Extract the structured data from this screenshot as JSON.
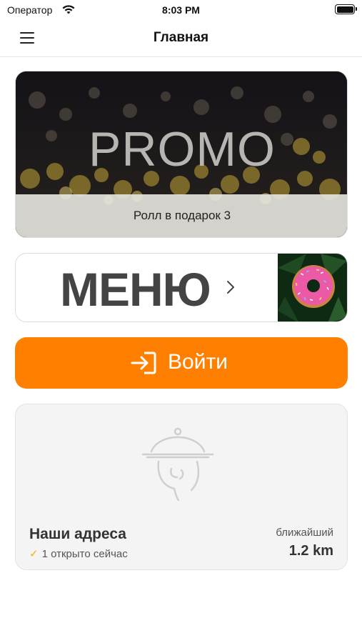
{
  "status_bar": {
    "carrier": "Оператор",
    "time": "8:03 PM"
  },
  "nav": {
    "title": "Главная"
  },
  "promo": {
    "image_text": "PROMO",
    "caption": "Ролл в подарок 3"
  },
  "menu": {
    "label": "МЕНЮ"
  },
  "login": {
    "label": "Войти"
  },
  "addresses": {
    "title": "Наши адреса",
    "open_now": "1 открыто сейчас",
    "nearest_label": "ближайший",
    "distance": "1.2 km"
  },
  "colors": {
    "accent": "#ff7f00",
    "check": "#f0b400"
  },
  "icons": [
    "wifi-icon",
    "battery-icon",
    "hamburger-menu-icon",
    "chevron-right-icon",
    "login-icon",
    "cloche-icon",
    "checkmark-icon"
  ]
}
